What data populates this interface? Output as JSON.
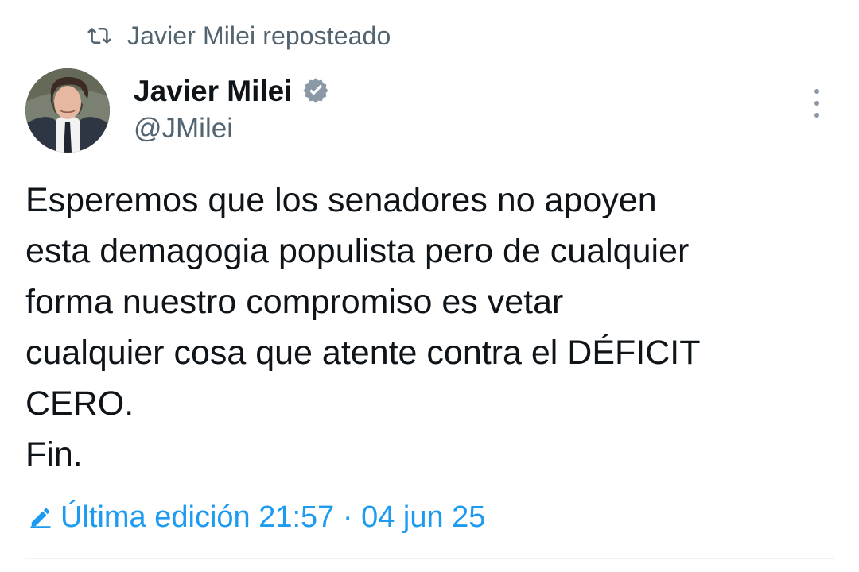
{
  "repost": {
    "label": "Javier Milei reposteado",
    "icon": "repost-icon"
  },
  "author": {
    "name": "Javier Milei",
    "handle": "@JMilei",
    "verified_icon": "verified-icon",
    "avatar_icon": "avatar"
  },
  "tweet": {
    "lines": [
      "Esperemos que los senadores no apoyen",
      "esta demagogia populista pero de cualquier",
      "forma nuestro compromiso es vetar",
      "cualquier cosa que atente contra el DÉFICIT",
      "CERO.",
      "Fin."
    ]
  },
  "edited": {
    "text": "Última edición 21:57 · 04 jun 25",
    "icon": "edit-icon"
  },
  "more_icon": "more-options-icon",
  "colors": {
    "text_primary": "#0f1419",
    "text_secondary": "#536471",
    "accent": "#1d9bf0",
    "divider": "#eff3f4"
  }
}
